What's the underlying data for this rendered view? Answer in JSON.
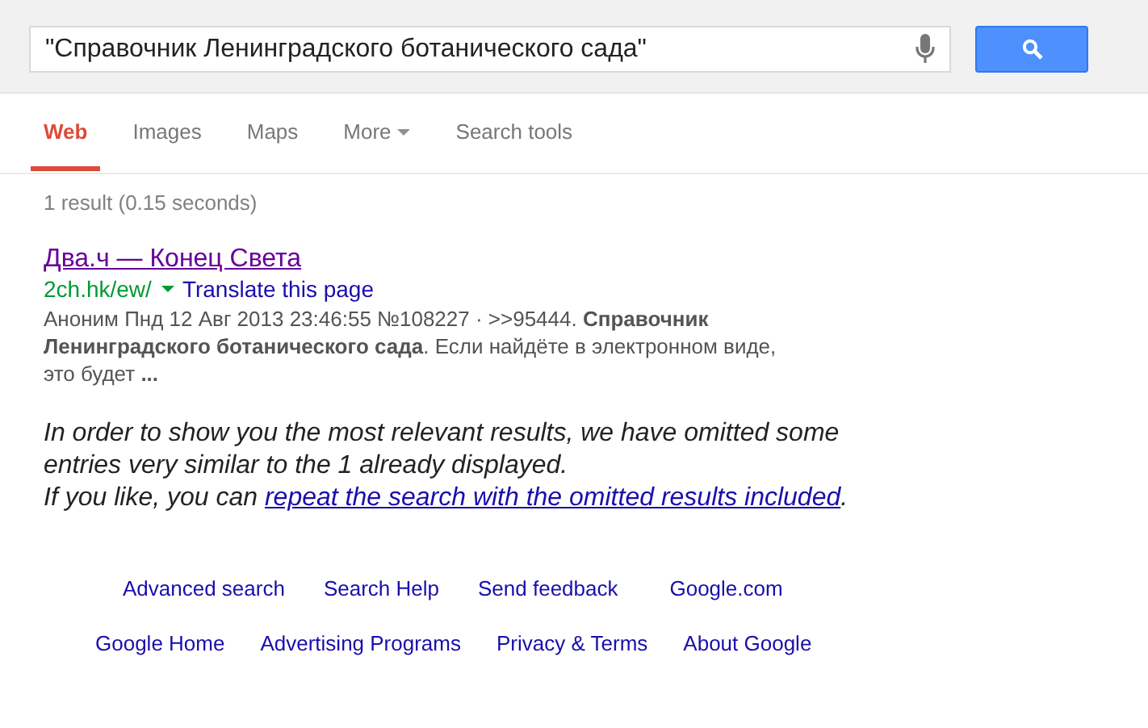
{
  "search": {
    "value": "\"Справочник Ленинградского ботанического сада\""
  },
  "tabs": [
    {
      "label": "Web",
      "selected": true,
      "kind": "tab"
    },
    {
      "label": "Images",
      "selected": false,
      "kind": "tab"
    },
    {
      "label": "Maps",
      "selected": false,
      "kind": "tab"
    },
    {
      "label": "More",
      "selected": false,
      "kind": "menu"
    },
    {
      "label": "Search tools",
      "selected": false,
      "kind": "tab"
    }
  ],
  "result_stats": "1 result (0.15 seconds)",
  "results": [
    {
      "title": "Два.ч — Конец Света",
      "url": "2ch.hk/ew/",
      "translate": "Translate this page",
      "snippet": "Аноним Пнд 12 Авг 2013 23:46:55 №108227 · >>95444. **Справочник Ленинградского ботанического сада**. Если найдёте в электронном виде, это будет **...**"
    }
  ],
  "omitted_notice": {
    "text": "In order to show you the most relevant results, we have omitted some entries very similar to the 1 already displayed.",
    "prefix": "If you like, you can ",
    "link": "repeat the search with the omitted results included",
    "suffix": "."
  },
  "footer_rows": [
    [
      "Advanced search",
      "Search Help",
      "Send feedback",
      "Google.com"
    ],
    [
      "Google Home",
      "Advertising Programs",
      "Privacy & Terms",
      "About Google"
    ]
  ]
}
